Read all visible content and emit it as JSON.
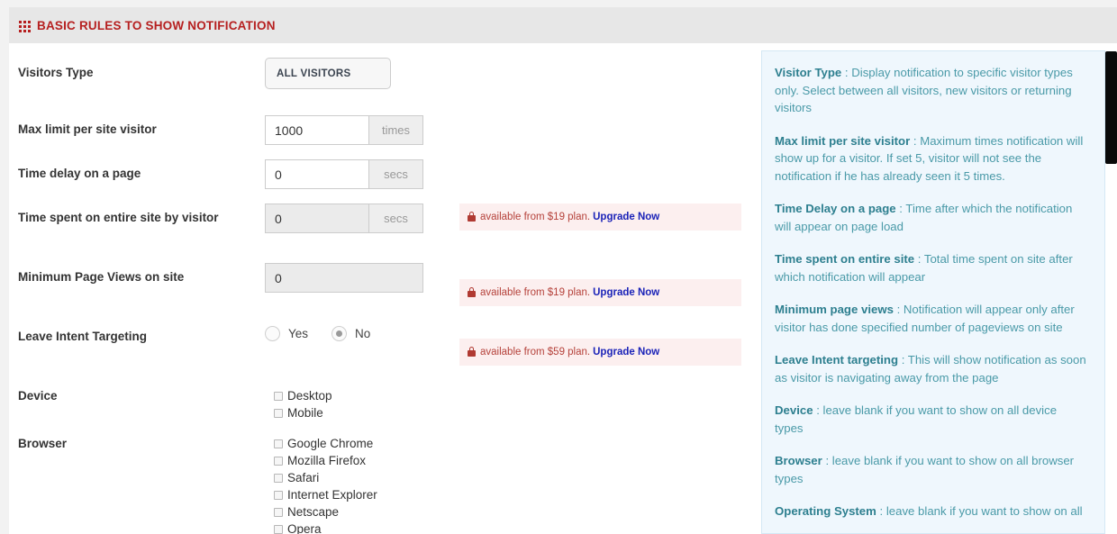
{
  "header": {
    "icon": "grid-icon",
    "title": "BASIC RULES TO SHOW NOTIFICATION",
    "accent": "#b62020"
  },
  "form": {
    "visitors_type": {
      "label": "Visitors Type",
      "value": "ALL VISITORS"
    },
    "max_limit": {
      "label": "Max limit per site visitor",
      "value": "1000",
      "addon": "times"
    },
    "time_delay": {
      "label": "Time delay on a page",
      "value": "0",
      "addon": "secs"
    },
    "time_spent": {
      "label": "Time spent on entire site by visitor",
      "value": "0",
      "addon": "secs"
    },
    "min_page_views": {
      "label": "Minimum Page Views on site",
      "value": "0"
    },
    "leave_intent": {
      "label": "Leave Intent Targeting",
      "yes": "Yes",
      "no": "No",
      "selected": "No"
    },
    "device": {
      "label": "Device",
      "options": [
        "Desktop",
        "Mobile"
      ]
    },
    "browser": {
      "label": "Browser",
      "options": [
        "Google Chrome",
        "Mozilla Firefox",
        "Safari",
        "Internet Explorer",
        "Netscape",
        "Opera"
      ]
    }
  },
  "notices": [
    {
      "icon": "lock-icon",
      "text": "available from $19 plan.",
      "link": "Upgrade Now"
    },
    {
      "icon": "lock-icon",
      "text": "available from $19 plan.",
      "link": "Upgrade Now"
    },
    {
      "icon": "lock-icon",
      "text": "available from $59 plan.",
      "link": "Upgrade Now"
    }
  ],
  "help": [
    {
      "title": "Visitor Type",
      "body": " : Display notification to specific visitor types only. Select between all visitors, new visitors or returning visitors"
    },
    {
      "title": "Max limit per site visitor",
      "body": " : Maximum times notification will show up for a visitor. If set 5, visitor will not see the notification if he has already seen it 5 times."
    },
    {
      "title": "Time Delay on a page",
      "body": " : Time after which the notification will appear on page load"
    },
    {
      "title": "Time spent on entire site",
      "body": " : Total time spent on site after which notification will appear"
    },
    {
      "title": "Minimum page views",
      "body": " : Notification will appear only after visitor has done specified number of pageviews on site"
    },
    {
      "title": "Leave Intent targeting",
      "body": " : This will show notification as soon as visitor is navigating away from the page"
    },
    {
      "title": "Device",
      "body": " : leave blank if you want to show on all device types"
    },
    {
      "title": "Browser",
      "body": " : leave blank if you want to show on all browser types"
    },
    {
      "title": "Operating System",
      "body": " : leave blank if you want to show on all"
    }
  ]
}
